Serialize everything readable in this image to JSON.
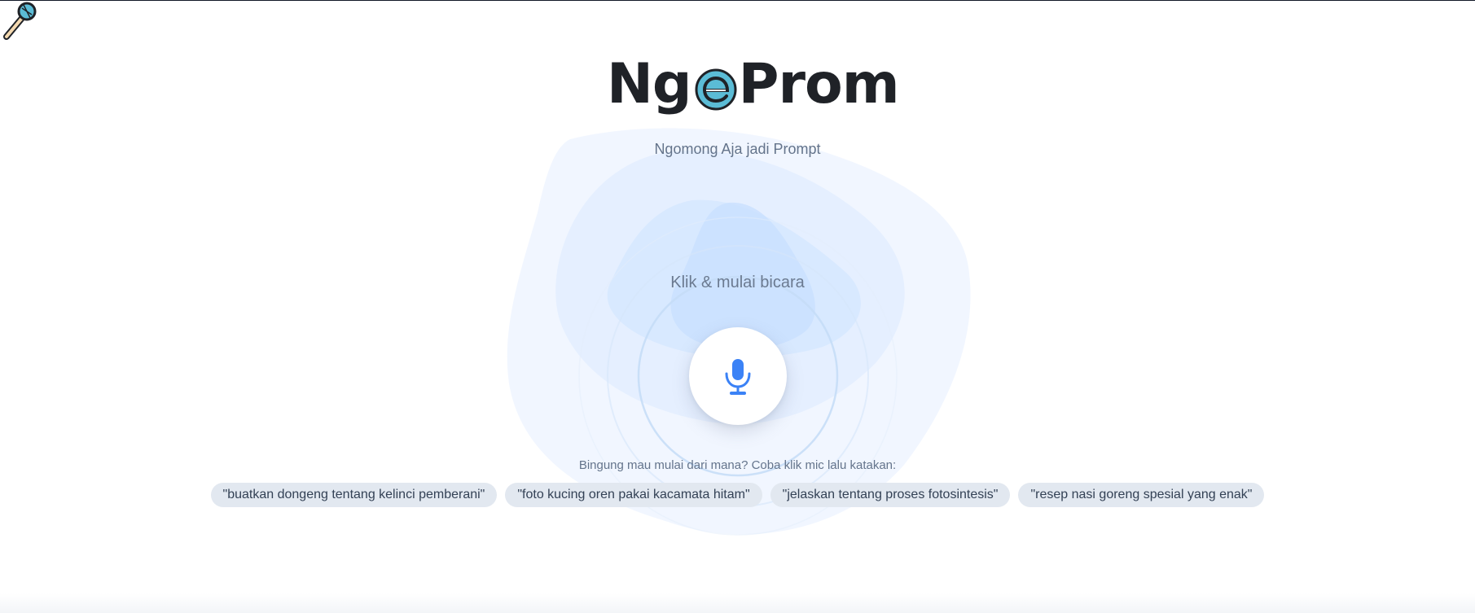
{
  "app": {
    "logo": {
      "prefix": "N",
      "g": "g",
      "e": "e",
      "suffix": "Prom",
      "icons": [
        "microphone-icon",
        "e-circle-icon"
      ]
    },
    "tagline": "Ngomong Aja jadi Prompt"
  },
  "recorder": {
    "label": "Klik & mulai bicara",
    "button_icon": "microphone-icon"
  },
  "suggestions": {
    "hint": "Bingung mau mulai dari mana? Coba klik mic lalu katakan:",
    "items": [
      "\"buatkan dongeng tentang kelinci pemberani\"",
      "\"foto kucing oren pakai kacamata hitam\"",
      "\"jelaskan tentang proses fotosintesis\"",
      "\"resep nasi goreng spesial yang enak\""
    ]
  },
  "colors": {
    "accent": "#3b82f6",
    "logo_text": "#1f2227",
    "logo_circle": "#5bbcd6",
    "chip_bg": "#e2e8f0",
    "muted_text": "#64748b"
  }
}
